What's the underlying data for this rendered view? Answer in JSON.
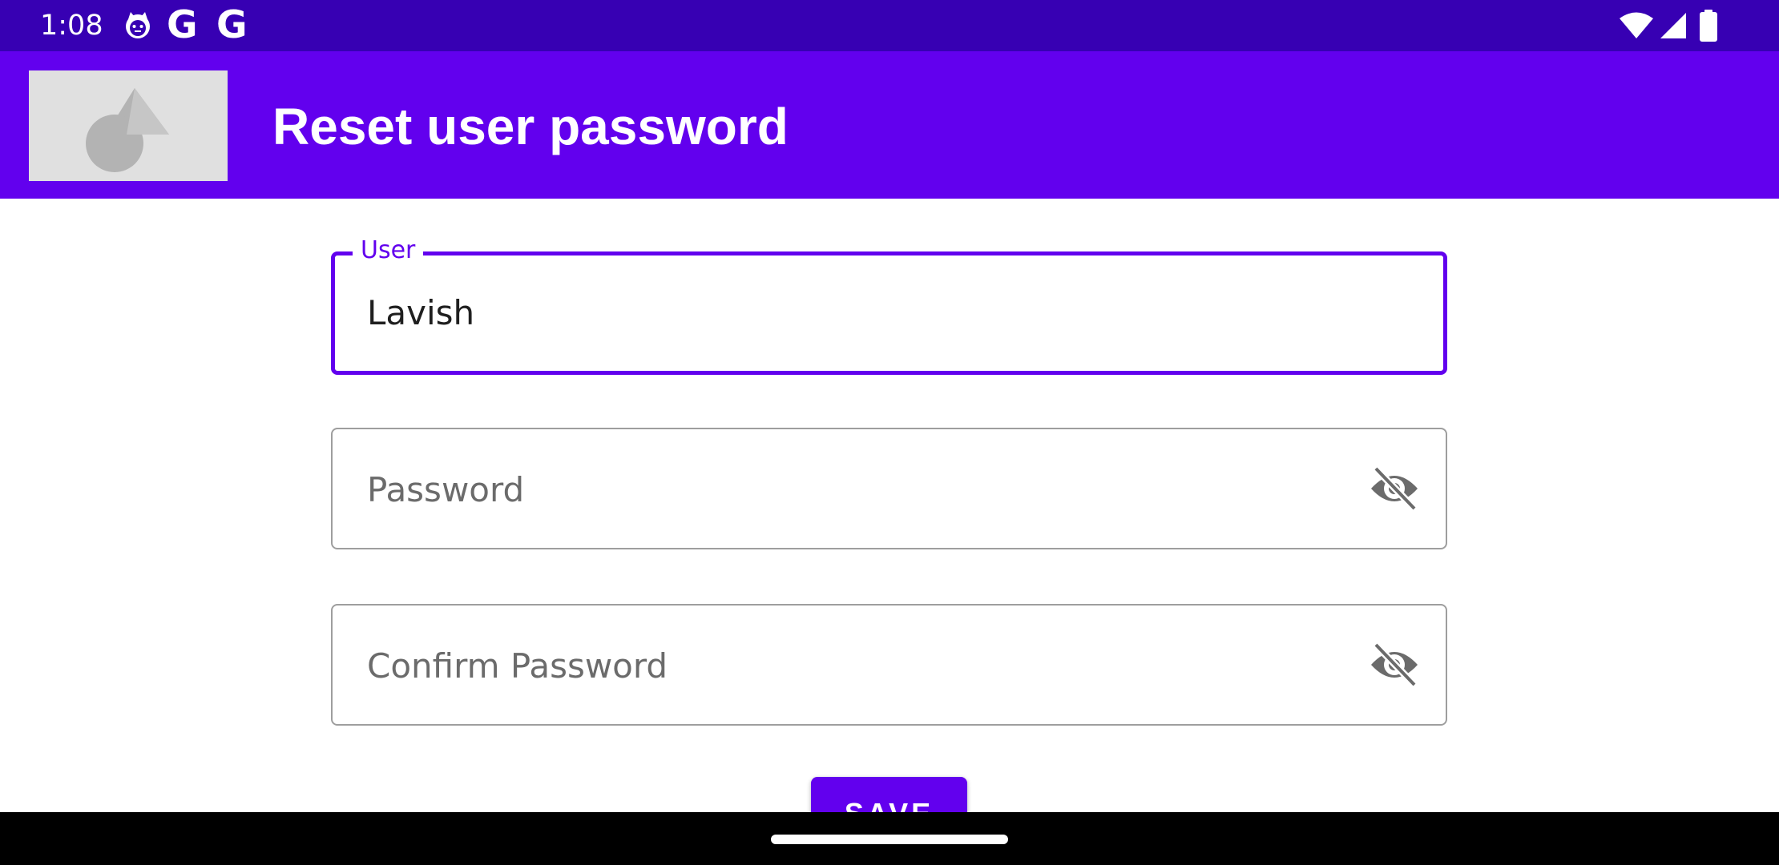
{
  "status_bar": {
    "time": "1:08",
    "icons": [
      "cat-notification-icon",
      "google-icon",
      "google-icon",
      "wifi-icon",
      "cell-signal-icon",
      "battery-icon"
    ],
    "google_glyph": "G",
    "background_color": "#3700b3"
  },
  "app_bar": {
    "title": "Reset user password",
    "logo": "placeholder-image-icon",
    "background_color": "#6200ee"
  },
  "form": {
    "user": {
      "label": "User",
      "value": "Lavish"
    },
    "password": {
      "placeholder": "Password",
      "toggle_icon": "visibility-off-icon"
    },
    "confirm_password": {
      "placeholder": "Confirm Password",
      "toggle_icon": "visibility-off-icon"
    },
    "save_label": "SAVE",
    "accent_color": "#6200ee"
  },
  "nav_bar": {
    "handle": "home-gesture-handle"
  }
}
